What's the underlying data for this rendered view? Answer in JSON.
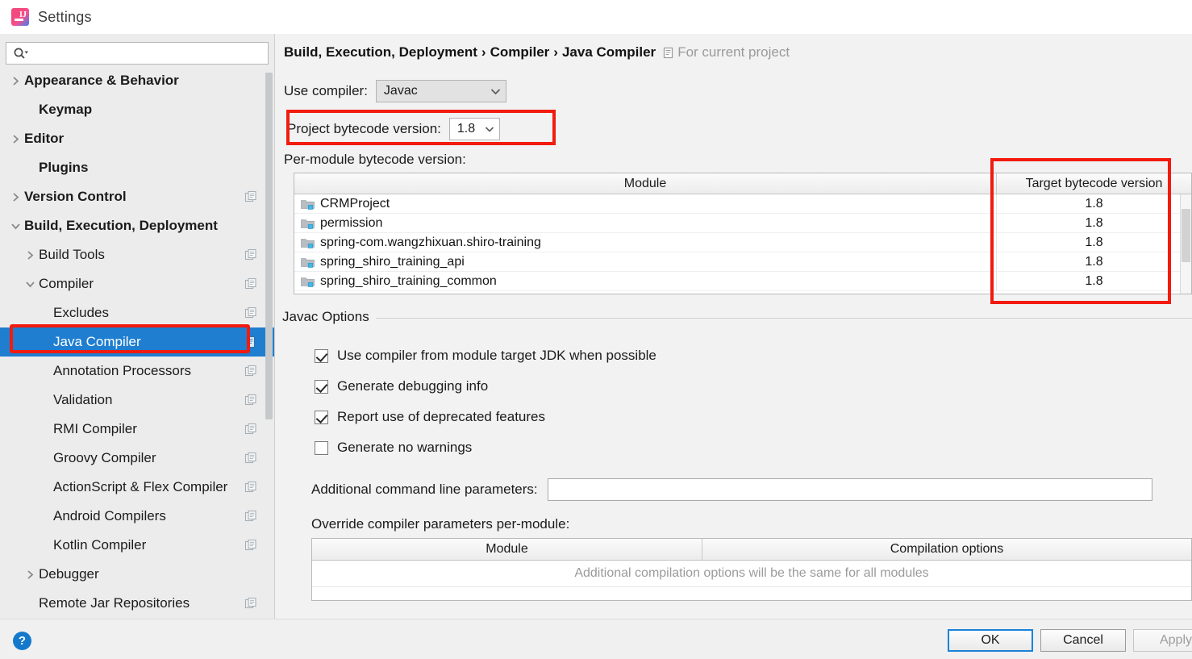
{
  "window": {
    "title": "Settings",
    "app_icon": "intellij-idea-icon"
  },
  "sidebar": {
    "search": {
      "value": "",
      "placeholder": "",
      "icon": "search-icon"
    },
    "items": [
      {
        "label": "Appearance & Behavior",
        "bold": true,
        "arrow": "right",
        "indent": 0,
        "badge": false,
        "selected": false
      },
      {
        "label": "Keymap",
        "bold": true,
        "arrow": "none",
        "indent": 1,
        "badge": false,
        "selected": false
      },
      {
        "label": "Editor",
        "bold": true,
        "arrow": "right",
        "indent": 0,
        "badge": false,
        "selected": false
      },
      {
        "label": "Plugins",
        "bold": true,
        "arrow": "none",
        "indent": 1,
        "badge": false,
        "selected": false
      },
      {
        "label": "Version Control",
        "bold": true,
        "arrow": "right",
        "indent": 0,
        "badge": true,
        "selected": false
      },
      {
        "label": "Build, Execution, Deployment",
        "bold": true,
        "arrow": "down",
        "indent": 0,
        "badge": false,
        "selected": false
      },
      {
        "label": "Build Tools",
        "bold": false,
        "arrow": "right",
        "indent": 1,
        "badge": true,
        "selected": false
      },
      {
        "label": "Compiler",
        "bold": false,
        "arrow": "down",
        "indent": 1,
        "badge": true,
        "selected": false
      },
      {
        "label": "Excludes",
        "bold": false,
        "arrow": "none",
        "indent": 2,
        "badge": true,
        "selected": false
      },
      {
        "label": "Java Compiler",
        "bold": false,
        "arrow": "none",
        "indent": 2,
        "badge": true,
        "selected": true
      },
      {
        "label": "Annotation Processors",
        "bold": false,
        "arrow": "none",
        "indent": 2,
        "badge": true,
        "selected": false
      },
      {
        "label": "Validation",
        "bold": false,
        "arrow": "none",
        "indent": 2,
        "badge": true,
        "selected": false
      },
      {
        "label": "RMI Compiler",
        "bold": false,
        "arrow": "none",
        "indent": 2,
        "badge": true,
        "selected": false
      },
      {
        "label": "Groovy Compiler",
        "bold": false,
        "arrow": "none",
        "indent": 2,
        "badge": true,
        "selected": false
      },
      {
        "label": "ActionScript & Flex Compiler",
        "bold": false,
        "arrow": "none",
        "indent": 2,
        "badge": true,
        "selected": false
      },
      {
        "label": "Android Compilers",
        "bold": false,
        "arrow": "none",
        "indent": 2,
        "badge": true,
        "selected": false
      },
      {
        "label": "Kotlin Compiler",
        "bold": false,
        "arrow": "none",
        "indent": 2,
        "badge": true,
        "selected": false
      },
      {
        "label": "Debugger",
        "bold": false,
        "arrow": "right",
        "indent": 1,
        "badge": false,
        "selected": false
      },
      {
        "label": "Remote Jar Repositories",
        "bold": false,
        "arrow": "none",
        "indent": 1,
        "badge": true,
        "selected": false
      }
    ]
  },
  "main": {
    "breadcrumb": {
      "parts": [
        "Build, Execution, Deployment",
        "Compiler",
        "Java Compiler"
      ],
      "separator": "›",
      "note": "For current project",
      "note_icon": "project-scope-icon"
    },
    "use_compiler": {
      "label": "Use compiler:",
      "value": "Javac"
    },
    "project_bytecode": {
      "label": "Project bytecode version:",
      "value": "1.8"
    },
    "per_module_label": "Per-module bytecode version:",
    "module_table": {
      "columns": [
        "Module",
        "Target bytecode version"
      ],
      "rows": [
        {
          "module": "CRMProject",
          "target": "1.8"
        },
        {
          "module": "permission",
          "target": "1.8"
        },
        {
          "module": "spring-com.wangzhixuan.shiro-training",
          "target": "1.8"
        },
        {
          "module": "spring_shiro_training_api",
          "target": "1.8"
        },
        {
          "module": "spring_shiro_training_common",
          "target": "1.8"
        }
      ]
    },
    "javac_options": {
      "title": "Javac Options",
      "checkboxes": [
        {
          "label": "Use compiler from module target JDK when possible",
          "checked": true
        },
        {
          "label": "Generate debugging info",
          "checked": true
        },
        {
          "label": "Report use of deprecated features",
          "checked": true
        },
        {
          "label": "Generate no warnings",
          "checked": false
        }
      ],
      "additional_params": {
        "label": "Additional command line parameters:",
        "value": "",
        "placeholder": ""
      },
      "override_label": "Override compiler parameters per-module:",
      "override_table": {
        "columns": [
          "Module",
          "Compilation options"
        ],
        "empty_text": "Additional compilation options will be the same for all modules"
      }
    }
  },
  "footer": {
    "help_label": "?",
    "ok_label": "OK",
    "cancel_label": "Cancel",
    "apply_label": "Apply"
  },
  "colors": {
    "selection_blue": "#1f7ed0",
    "annotation_red": "#f21b0e",
    "help_blue": "#1479cc",
    "muted_text": "#9b9b9b"
  }
}
